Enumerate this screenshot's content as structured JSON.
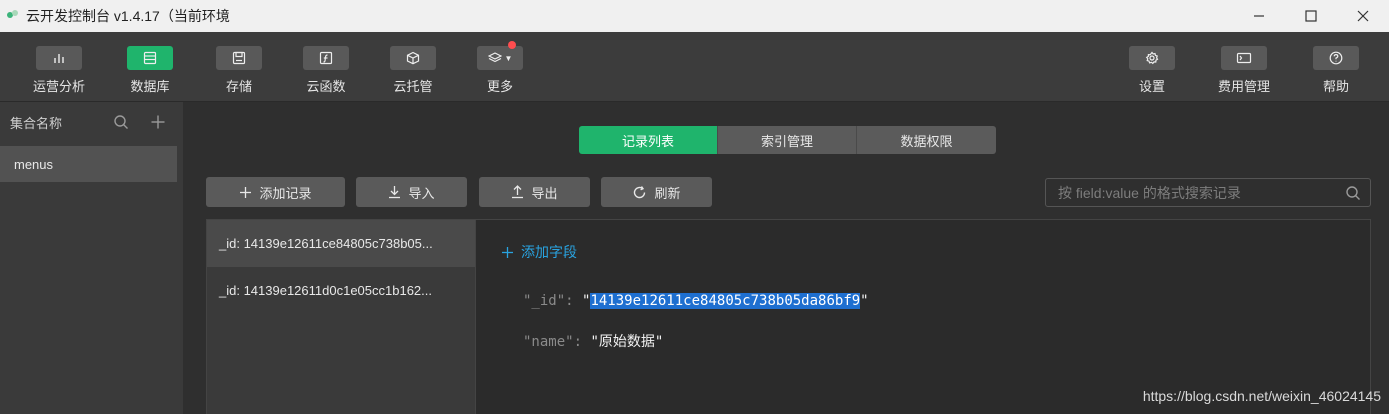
{
  "window": {
    "title": "云开发控制台 v1.4.17（当前环境",
    "controls": {
      "minimize": "minimize",
      "maximize": "maximize",
      "close": "close"
    }
  },
  "toolbar": {
    "left": [
      {
        "label": "运营分析",
        "icon": "bar-chart-icon",
        "active": false
      },
      {
        "label": "数据库",
        "icon": "database-icon",
        "active": true
      },
      {
        "label": "存储",
        "icon": "storage-icon",
        "active": false
      },
      {
        "label": "云函数",
        "icon": "function-icon",
        "active": false
      },
      {
        "label": "云托管",
        "icon": "cube-icon",
        "active": false
      },
      {
        "label": "更多",
        "icon": "layers-icon",
        "active": false,
        "badge": true
      }
    ],
    "right": [
      {
        "label": "设置",
        "icon": "gear-icon"
      },
      {
        "label": "费用管理",
        "icon": "billing-icon"
      },
      {
        "label": "帮助",
        "icon": "help-icon"
      }
    ]
  },
  "sidebar": {
    "header": "集合名称",
    "items": [
      {
        "label": "menus",
        "selected": true
      }
    ]
  },
  "tabs": [
    {
      "label": "记录列表",
      "active": true
    },
    {
      "label": "索引管理",
      "active": false
    },
    {
      "label": "数据权限",
      "active": false
    }
  ],
  "actions": {
    "add": "添加记录",
    "import": "导入",
    "export": "导出",
    "refresh": "刷新"
  },
  "search": {
    "placeholder": "按 field:value 的格式搜索记录",
    "value": ""
  },
  "records": [
    {
      "label": "_id: 14139e12611ce84805c738b05...",
      "selected": true
    },
    {
      "label": "_id: 14139e12611d0c1e05cc1b162...",
      "selected": false
    }
  ],
  "detail": {
    "add_field": "添加字段",
    "fields": [
      {
        "key": "\"_id\"",
        "colon": ": ",
        "quote_open": "\"",
        "value": "14139e12611ce84805c738b05da86bf9",
        "quote_close": "\"",
        "highlighted": true
      },
      {
        "key": "\"name\"",
        "colon": ": ",
        "quote_open": "\"",
        "value": "原始数据",
        "quote_close": "\"",
        "highlighted": false
      }
    ]
  },
  "watermark": "https://blog.csdn.net/weixin_46024145",
  "colors": {
    "accent": "#1fb46c",
    "link": "#29a3e0",
    "badge": "#ff4d4f",
    "selection": "#1e6fd0"
  }
}
